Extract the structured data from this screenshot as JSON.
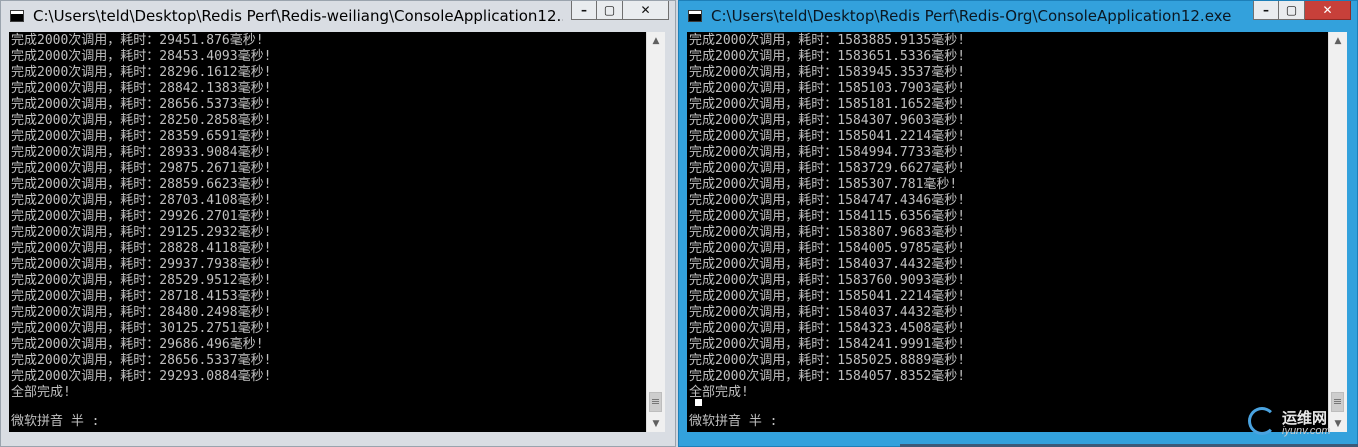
{
  "left_window": {
    "title": "C:\\Users\\teld\\Desktop\\Redis Perf\\Redis-weiliang\\ConsoleApplication12...",
    "controls": {
      "minimize": "–",
      "maximize": "▢",
      "close": "✕"
    },
    "lines": [
      "完成2000次调用，耗时：29451.876毫秒!",
      "完成2000次调用，耗时：28453.4093毫秒!",
      "完成2000次调用，耗时：28296.1612毫秒!",
      "完成2000次调用，耗时：28842.1383毫秒!",
      "完成2000次调用，耗时：28656.5373毫秒!",
      "完成2000次调用，耗时：28250.2858毫秒!",
      "完成2000次调用，耗时：28359.6591毫秒!",
      "完成2000次调用，耗时：28933.9084毫秒!",
      "完成2000次调用，耗时：29875.2671毫秒!",
      "完成2000次调用，耗时：28859.6623毫秒!",
      "完成2000次调用，耗时：28703.4108毫秒!",
      "完成2000次调用，耗时：29926.2701毫秒!",
      "完成2000次调用，耗时：29125.2932毫秒!",
      "完成2000次调用，耗时：28828.4118毫秒!",
      "完成2000次调用，耗时：29937.7938毫秒!",
      "完成2000次调用，耗时：28529.9512毫秒!",
      "完成2000次调用，耗时：28718.4153毫秒!",
      "完成2000次调用，耗时：28480.2498毫秒!",
      "完成2000次调用，耗时：30125.2751毫秒!",
      "完成2000次调用，耗时：29686.496毫秒!",
      "完成2000次调用，耗时：28656.5337毫秒!",
      "完成2000次调用，耗时：29293.0884毫秒!",
      "全部完成!"
    ],
    "ime_status": "微软拼音 半 :"
  },
  "right_window": {
    "title": "C:\\Users\\teld\\Desktop\\Redis Perf\\Redis-Org\\ConsoleApplication12.exe",
    "controls": {
      "minimize": "–",
      "maximize": "▢",
      "close": "✕"
    },
    "lines": [
      "完成2000次调用，耗时：1583885.9135毫秒!",
      "完成2000次调用，耗时：1583651.5336毫秒!",
      "完成2000次调用，耗时：1583945.3537毫秒!",
      "完成2000次调用，耗时：1585103.7903毫秒!",
      "完成2000次调用，耗时：1585181.1652毫秒!",
      "完成2000次调用，耗时：1584307.9603毫秒!",
      "完成2000次调用，耗时：1585041.2214毫秒!",
      "完成2000次调用，耗时：1584994.7733毫秒!",
      "完成2000次调用，耗时：1583729.6627毫秒!",
      "完成2000次调用，耗时：1585307.781毫秒!",
      "完成2000次调用，耗时：1584747.4346毫秒!",
      "完成2000次调用，耗时：1584115.6356毫秒!",
      "完成2000次调用，耗时：1583807.9683毫秒!",
      "完成2000次调用，耗时：1584005.9785毫秒!",
      "完成2000次调用，耗时：1584037.4432毫秒!",
      "完成2000次调用，耗时：1583760.9093毫秒!",
      "完成2000次调用，耗时：1585041.2214毫秒!",
      "完成2000次调用，耗时：1584037.4432毫秒!",
      "完成2000次调用，耗时：1584323.4508毫秒!",
      "完成2000次调用，耗时：1584241.9991毫秒!",
      "完成2000次调用，耗时：1585025.8889毫秒!",
      "完成2000次调用，耗时：1584057.8352毫秒!",
      "全部完成!"
    ],
    "ime_status": "微软拼音 半 :"
  },
  "watermark": {
    "name": "运维网",
    "url": "iyunv.com"
  },
  "colors": {
    "console_bg": "#000000",
    "console_text": "#c0c0c0",
    "active_titlebar": "#33a1dc",
    "inactive_titlebar": "#d9dde3"
  }
}
